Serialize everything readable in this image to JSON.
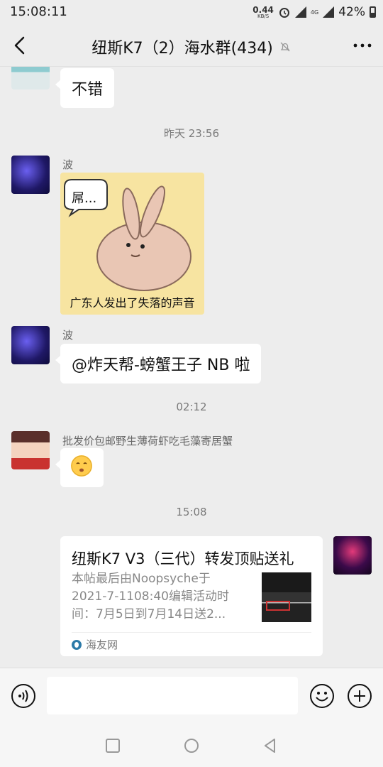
{
  "status_bar": {
    "time": "15:08:11",
    "net_speed": "0.44",
    "net_unit": "KB/S",
    "network_type": "4G",
    "battery": "42%"
  },
  "header": {
    "title": "纽斯K7（2）海水群(434)",
    "icons": [
      "back-arrow-icon",
      "muted-bell-icon",
      "more-icon"
    ]
  },
  "messages": {
    "m0_text": "不错",
    "t1": "昨天 23:56",
    "m1_sender": "波",
    "m1_sticker_caption": "广东人发出了失落的声音",
    "m1_sticker_bubble": "屌...",
    "m2_sender": "波",
    "m2_text": "@炸天帮-螃蟹王子  NB 啦",
    "t2": "02:12",
    "m3_sender": "批发价包邮野生薄荷虾吃毛藻寄居蟹",
    "m3_emoji": "pouting-face",
    "t3": "15:08",
    "card": {
      "title": "纽斯K7 V3（三代）转发顶贴送礼",
      "desc_line1": "本帖最后由Noopsyche于",
      "desc_line2": "2021-7-1108:40编辑活动时",
      "desc_line3": "间：7月5日到7月14日送2...",
      "source": "海友网"
    }
  },
  "input_bar": {
    "icons": [
      "voice-icon",
      "emoji-icon",
      "plus-icon"
    ]
  },
  "colors": {
    "background": "#ededed",
    "bubble": "#ffffff",
    "time_text": "#7a7a7a"
  }
}
